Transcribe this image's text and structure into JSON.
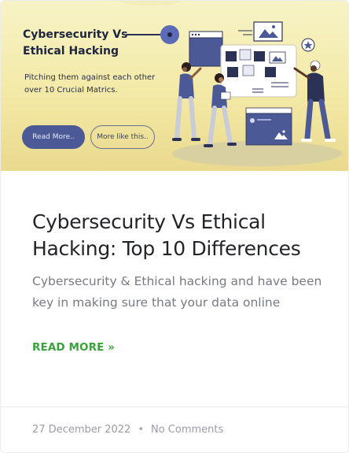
{
  "hero": {
    "title": "Cybersecurity Vs Ethical Hacking",
    "subtitle": "Pitching them against each other over 10 Crucial Matrics.",
    "primary_button": "Read More..",
    "secondary_button": "More like this..",
    "colors": {
      "background_top": "#f7f3c6",
      "background_bottom": "#ead98e",
      "accent_blue": "#4b5a97",
      "dark_navy": "#1e2540"
    }
  },
  "post": {
    "title": "Cybersecurity Vs Ethical Hacking: Top 10 Differences",
    "excerpt": "Cybersecurity & Ethical hacking and have been key in making sure that your data online",
    "read_more": "READ MORE »",
    "read_more_color": "#3aa23a"
  },
  "meta": {
    "date": "27 December 2022",
    "separator": "•",
    "comments": "No Comments"
  }
}
